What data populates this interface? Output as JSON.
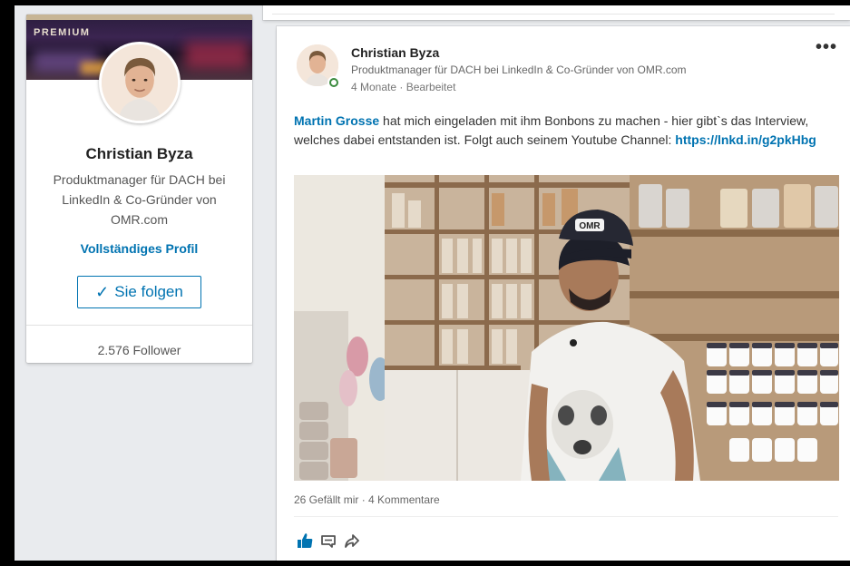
{
  "profile_card": {
    "premium_label": "PREMIUM",
    "name": "Christian Byza",
    "headline": "Produktmanager für DACH bei LinkedIn & Co-Gründer von OMR.com",
    "full_profile_link": "Vollständiges Profil",
    "follow_button": {
      "icon": "✓",
      "label": "Sie folgen"
    },
    "follower_count": "2.576 Follower"
  },
  "post": {
    "author_name": "Christian Byza",
    "author_headline": "Produktmanager für DACH bei LinkedIn & Co-Gründer von OMR.com",
    "meta": "4 Monate · Bearbeitet",
    "more_label": "•••",
    "text": {
      "mention": "Martin Grosse",
      "body": " hat mich eingeladen mit ihm Bonbons zu machen - hier gibt`s das Interview, welches dabei entstanden ist. Folgt auch seinem Youtube Channel: ",
      "link": "https://lnkd.in/g2pkHbg"
    },
    "video_cap_text": "OMR",
    "social_counts": "26 Gefällt mir · 4 Kommentare",
    "actions": {
      "like_icon": "thumbs-up-icon",
      "comment_icon": "comment-icon",
      "share_icon": "share-icon"
    }
  },
  "colors": {
    "link_blue": "#0073b1",
    "like_active": "#0073b1",
    "online_green": "#3b8b3e",
    "background": "#e9ebee"
  }
}
